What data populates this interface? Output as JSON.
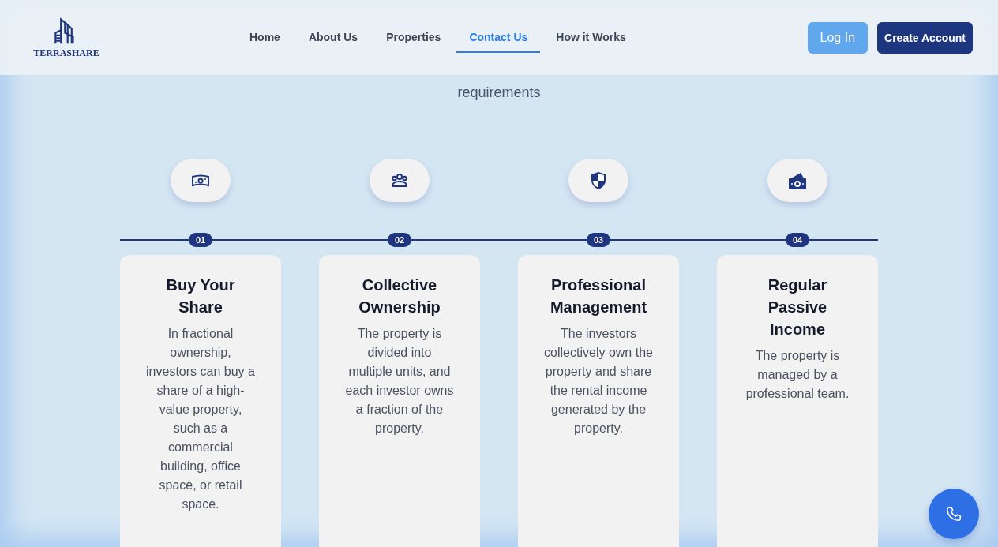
{
  "brand": {
    "name": "TERRASHARE"
  },
  "nav": [
    {
      "label": "Home",
      "selected": false
    },
    {
      "label": "About Us",
      "selected": false
    },
    {
      "label": "Properties",
      "selected": false
    },
    {
      "label": "Contact Us",
      "selected": true
    },
    {
      "label": "How it Works",
      "selected": false
    }
  ],
  "auth": {
    "login": "Log In",
    "signup": "Create Account"
  },
  "subtitle": "requirements",
  "steps": [
    {
      "number": "01",
      "title": "Buy Your Share",
      "text": "In fractional ownership, investors can buy a share of a high-value property, such as a commercial building, office space, or retail space."
    },
    {
      "number": "02",
      "title": "Collective Ownership",
      "text": "The property is divided into multiple units, and each investor owns a fraction of the property."
    },
    {
      "number": "03",
      "title": "Professional Management",
      "text": "The investors collectively own the property and share the rental income generated by the property."
    },
    {
      "number": "04",
      "title": "Regular Passive Income",
      "text": "The property is managed by a professional team."
    }
  ]
}
